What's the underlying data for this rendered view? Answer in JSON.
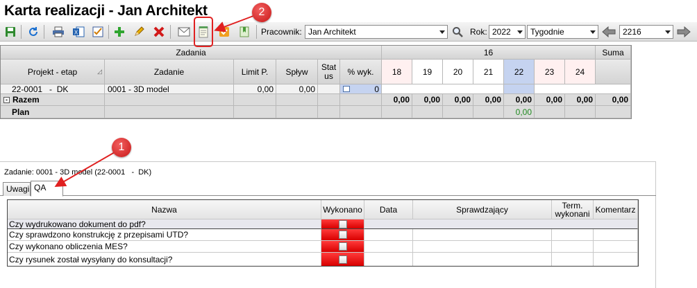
{
  "window": {
    "title": "Karta realizacji - Jan Architekt"
  },
  "toolbar": {
    "icons": [
      "save-icon",
      "refresh-icon",
      "print-icon",
      "excel-icon",
      "checklist-icon",
      "add-icon",
      "edit-icon",
      "delete-icon",
      "email-icon",
      "notes-icon",
      "task-icon",
      "bookmark-icon",
      "search-icon",
      "arrow-left-icon",
      "arrow-right-icon"
    ],
    "employee_label": "Pracownik:",
    "employee_value": "Jan Architekt",
    "year_label": "Rok:",
    "year_value": "2022",
    "period_value": "Tygodnie",
    "week_value": "2216"
  },
  "annotations": {
    "badge_1": "1",
    "badge_2": "2"
  },
  "grid": {
    "group_headers": {
      "tasks": "Zadania",
      "week": "16",
      "sum": "Suma"
    },
    "columns": {
      "project": "Projekt - etap",
      "task": "Zadanie",
      "limit": "Limit P.",
      "inflow": "Spływ",
      "status": "Stat us",
      "percent": "% wyk.",
      "days": [
        "18",
        "19",
        "20",
        "21",
        "22",
        "23",
        "24"
      ]
    },
    "row": {
      "project": "22-0001   -  DK",
      "task": "0001 - 3D model",
      "limit": "0,00",
      "inflow": "0,00",
      "percent": "0"
    },
    "total": {
      "label": "Razem",
      "days": [
        "0,00",
        "0,00",
        "0,00",
        "0,00",
        "0,00",
        "0,00",
        "0,00"
      ],
      "sum": "0,00"
    },
    "plan": {
      "label": "Plan",
      "value_22": "0,00"
    },
    "colors": {
      "selected_day": "#c5d3f0",
      "weekend_day": "#fff0f0",
      "plan_value": "#1f8a1f"
    }
  },
  "details": {
    "task_label": "Zadanie: 0001 - 3D model (22-0001   -  DK)",
    "tabs": [
      "Uwagi",
      "QA"
    ],
    "active_tab": "QA",
    "qa": {
      "columns": [
        "Nazwa",
        "Wykonano",
        "Data",
        "Sprawdzający",
        "Term. wykonani",
        "Komentarz"
      ],
      "rows": [
        "Czy wydrukowano dokument do pdf?",
        "Czy sprawdzono konstrukcję z przepisami UTD?",
        "Czy wykonano obliczenia MES?",
        "Czy rysunek został wysyłany do konsultacji?"
      ]
    }
  }
}
